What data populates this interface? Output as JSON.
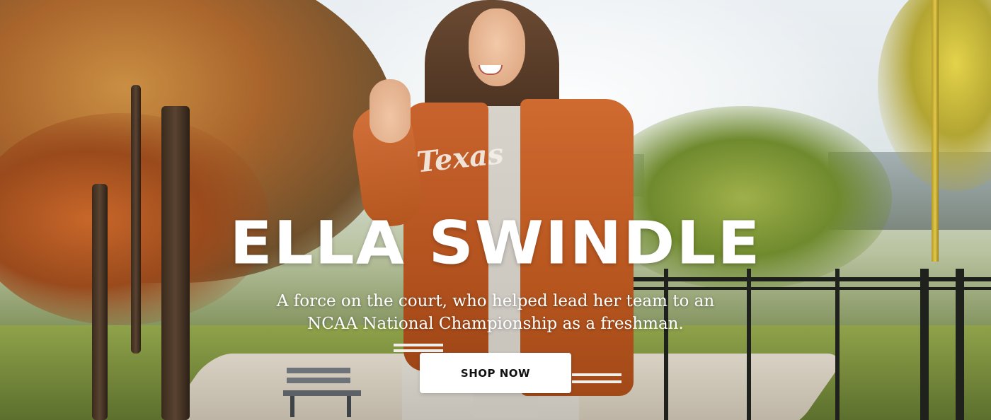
{
  "hero": {
    "headline": "ELLA SWINDLE",
    "subtitle_line1": "A force on the court, who helped lead her team to an",
    "subtitle_line2": "NCAA National Championship as a freshman.",
    "cta_label": "SHOP NOW",
    "jacket_script": "Texas"
  },
  "colors": {
    "headline": "#ffffff",
    "button_bg": "#ffffff",
    "button_text": "#111111",
    "jacket": "#bf5a24"
  }
}
